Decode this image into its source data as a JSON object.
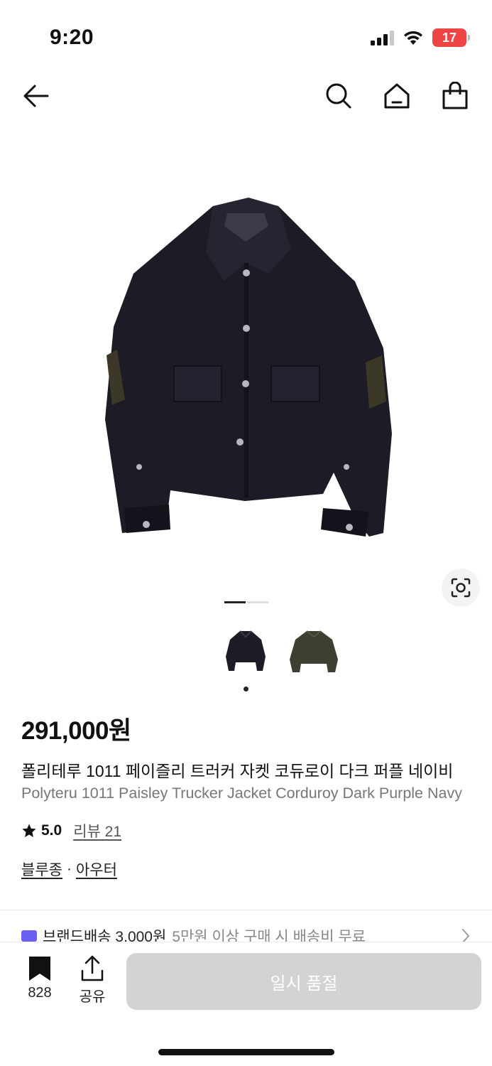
{
  "status_bar": {
    "time": "9:20",
    "battery": "17"
  },
  "nav": {
    "back_icon": "back-arrow-icon",
    "search_icon": "search-icon",
    "home_icon": "home-icon",
    "cart_icon": "shopping-bag-icon"
  },
  "gallery": {
    "image_count": 2,
    "active_index": 0
  },
  "product": {
    "price": "291,000원",
    "title_ko": "폴리테루 1011 페이즐리 트러커 자켓 코듀로이 다크 퍼플 네이비",
    "title_en": "Polyteru 1011 Paisley Trucker Jacket Corduroy Dark Purple Navy",
    "rating": "5.0",
    "review": "리뷰 21",
    "category_1": "블루종",
    "separator": "·",
    "category_2": "아우터"
  },
  "shipping": {
    "brand": "브랜드배송 3,000원",
    "desc": "5만원 이상 구매 시 배송비 무료"
  },
  "bottom": {
    "bookmark_count": "828",
    "share_label": "공유",
    "cta_label": "일시 품절"
  },
  "colors": {
    "accent": "#6a5ff0",
    "soldout": "#d3d3d3",
    "battery": "#ef4444"
  }
}
